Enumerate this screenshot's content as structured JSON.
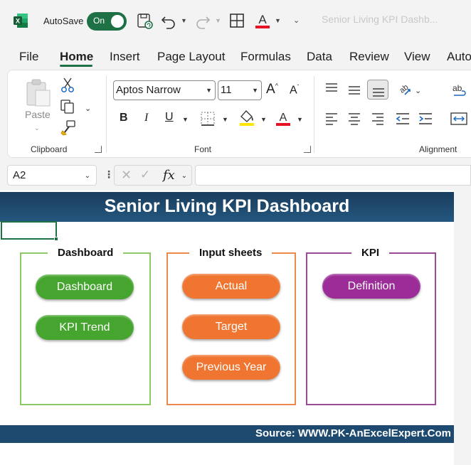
{
  "titlebar": {
    "autosave_label": "AutoSave",
    "autosave_state": "On",
    "document_title": "Senior Living KPI Dashb..."
  },
  "tabs": [
    {
      "label": "File"
    },
    {
      "label": "Home"
    },
    {
      "label": "Insert"
    },
    {
      "label": "Page Layout"
    },
    {
      "label": "Formulas"
    },
    {
      "label": "Data"
    },
    {
      "label": "Review"
    },
    {
      "label": "View"
    },
    {
      "label": "Auto"
    }
  ],
  "ribbon": {
    "clipboard": {
      "label": "Clipboard",
      "paste_label": "Paste"
    },
    "font": {
      "label": "Font",
      "font_name": "Aptos Narrow",
      "font_size": "11"
    },
    "alignment": {
      "label": "Alignment"
    }
  },
  "formula_bar": {
    "name_box": "A2",
    "formula": ""
  },
  "dashboard": {
    "title": "Senior Living KPI Dashboard",
    "footer": "Source: WWW.PK-AnExcelExpert.Com",
    "panels": [
      {
        "title": "Dashboard",
        "buttons": [
          "Dashboard",
          "KPI Trend"
        ]
      },
      {
        "title": "Input sheets",
        "buttons": [
          "Actual",
          "Target",
          "Previous Year"
        ]
      },
      {
        "title": "KPI",
        "buttons": [
          "Definition"
        ]
      }
    ]
  },
  "colors": {
    "excel_green": "#1e7145",
    "header_blue": "#1a3d5c",
    "pill_green": "#45a52e",
    "pill_orange": "#ef7530",
    "pill_purple": "#9b2c98",
    "panel_green": "#8cc864",
    "panel_orange": "#e98a4c",
    "panel_purple": "#9b4a98",
    "font_color_red": "#e81123",
    "highlight_yellow": "#ffe600"
  },
  "icons": [
    "excel-logo-icon",
    "save-icon",
    "undo-icon",
    "redo-icon",
    "borders-icon",
    "font-color-icon",
    "customize-qat-icon",
    "paste-icon",
    "cut-icon",
    "copy-icon",
    "format-painter-icon",
    "fill-color-icon",
    "align-top-icon",
    "align-middle-icon",
    "align-bottom-icon",
    "orientation-icon",
    "align-left-icon",
    "align-center-icon",
    "align-right-icon",
    "decrease-indent-icon",
    "increase-indent-icon",
    "wrap-text-icon",
    "merge-center-icon",
    "fx-icon"
  ]
}
